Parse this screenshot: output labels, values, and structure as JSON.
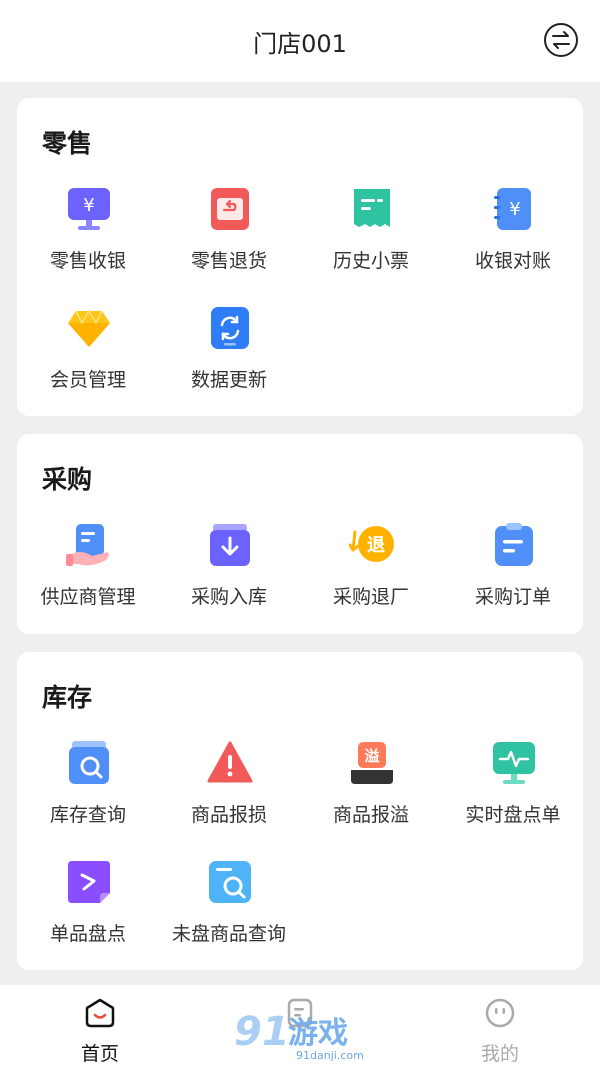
{
  "header": {
    "title": "门店001",
    "switch_icon": "switch-store-icon"
  },
  "sections": [
    {
      "title": "零售",
      "items": [
        {
          "label": "零售收银",
          "icon": "cashier-icon"
        },
        {
          "label": "零售退货",
          "icon": "return-icon"
        },
        {
          "label": "历史小票",
          "icon": "receipt-icon"
        },
        {
          "label": "收银对账",
          "icon": "reconcile-icon"
        },
        {
          "label": "会员管理",
          "icon": "diamond-icon"
        },
        {
          "label": "数据更新",
          "icon": "refresh-icon"
        }
      ]
    },
    {
      "title": "采购",
      "items": [
        {
          "label": "供应商管理",
          "icon": "supplier-icon"
        },
        {
          "label": "采购入库",
          "icon": "inbound-icon"
        },
        {
          "label": "采购退厂",
          "icon": "return-to-factory-icon",
          "badge": "退"
        },
        {
          "label": "采购订单",
          "icon": "order-clipboard-icon"
        }
      ]
    },
    {
      "title": "库存",
      "items": [
        {
          "label": "库存查询",
          "icon": "inventory-search-icon"
        },
        {
          "label": "商品报损",
          "icon": "warning-icon"
        },
        {
          "label": "商品报溢",
          "icon": "overflow-icon",
          "badge": "溢"
        },
        {
          "label": "实时盘点单",
          "icon": "realtime-count-icon"
        },
        {
          "label": "单品盘点",
          "icon": "single-count-icon"
        },
        {
          "label": "未盘商品查询",
          "icon": "uncounted-search-icon"
        }
      ]
    }
  ],
  "tabbar": [
    {
      "label": "首页",
      "icon": "home-icon",
      "active": true
    },
    {
      "label": "",
      "icon": "document-icon",
      "active": false
    },
    {
      "label": "我的",
      "icon": "profile-icon",
      "active": false
    }
  ],
  "watermark": {
    "big": "91游戏",
    "small": "91danji.com"
  },
  "colors": {
    "accent": "#e94b3c",
    "text": "#333333",
    "inactive": "#aaaaaa",
    "background": "#efefef"
  }
}
